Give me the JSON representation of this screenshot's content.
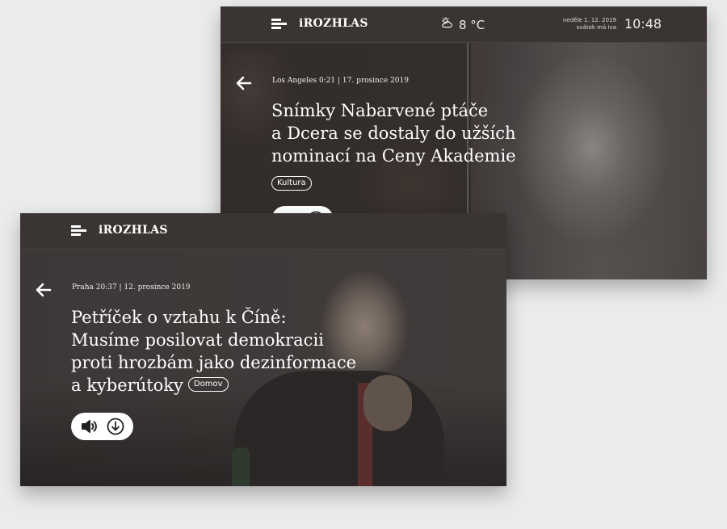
{
  "card_top": {
    "brand": "iROZHLAS",
    "weather": {
      "icon": "partly-cloudy-icon",
      "temperature": "8 °C"
    },
    "date_line1": "neděle 1. 12. 2019",
    "date_line2": "svátek má Iva",
    "time": "10:48",
    "meta": "Los Angeles 0:21 | 17. prosince 2019",
    "headline_lines": [
      "Snímky Nabarvené ptáče",
      "a Dcera se dostaly do užších",
      "nominací na Ceny Akademie"
    ],
    "tag": "Kultura"
  },
  "card_bottom": {
    "brand": "iROZHLAS",
    "meta": "Praha 20:37 | 12. prosince 2019",
    "headline_lines": [
      "Petříček o vztahu k Číně:",
      "Musíme posilovat demokracii",
      "proti hrozbám jako dezinformace",
      "a kyberútoky"
    ],
    "tag": "Domov"
  },
  "colors": {
    "page_background": "#ebebeb",
    "card_background": "#3a3533",
    "text": "#ffffff"
  },
  "icons": [
    "menu-icon",
    "back-arrow-icon",
    "speaker-icon",
    "download-icon",
    "partly-cloudy-icon"
  ]
}
